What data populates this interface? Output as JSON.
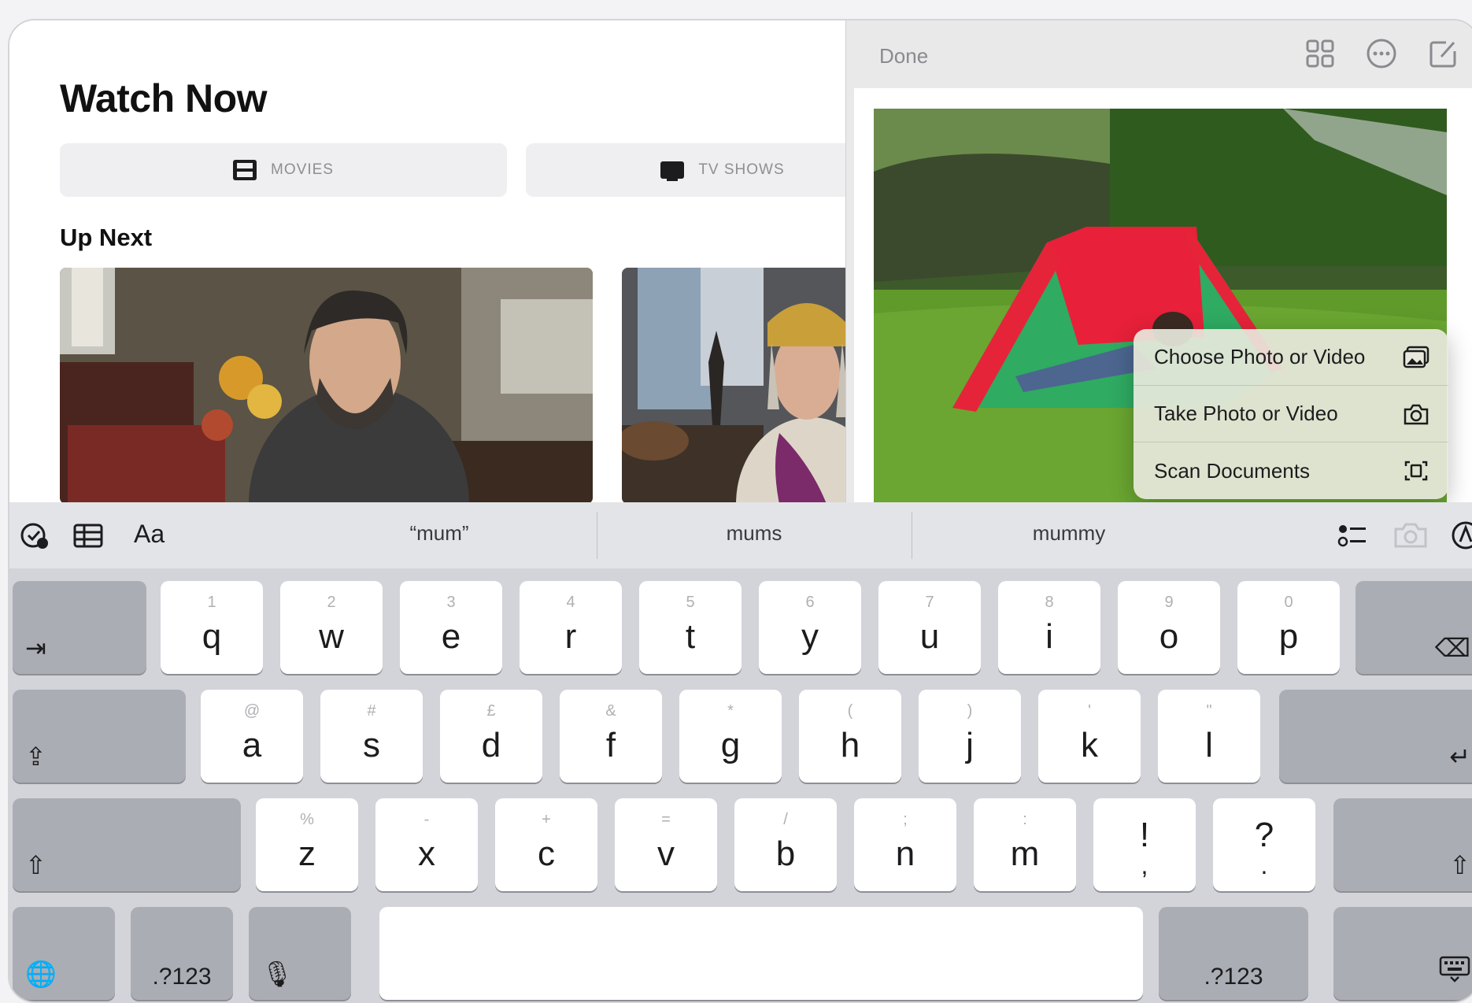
{
  "tv_app": {
    "title": "Watch Now",
    "segments": [
      "MOVIES",
      "TV SHOWS"
    ],
    "section_title": "Up Next"
  },
  "notes": {
    "done_label": "Done",
    "toolbar_icons": [
      "gallery-grid-icon",
      "more-ellipsis-icon",
      "compose-icon"
    ]
  },
  "attach_menu": {
    "items": [
      {
        "label": "Choose Photo or Video",
        "icon": "photo-library-icon"
      },
      {
        "label": "Take Photo or Video",
        "icon": "camera-icon"
      },
      {
        "label": "Scan Documents",
        "icon": "scan-document-icon"
      }
    ]
  },
  "keyboard": {
    "suggestions": [
      "“mum”",
      "mums",
      "mummy"
    ],
    "quick_icons_left": [
      "checklist-text-icon",
      "table-icon",
      "format-text-icon"
    ],
    "format_label": "Aa",
    "quick_icons_right": [
      "checklist-icon",
      "camera-icon",
      "markup-icon"
    ],
    "row1": [
      {
        "main": "q",
        "hint": "1"
      },
      {
        "main": "w",
        "hint": "2"
      },
      {
        "main": "e",
        "hint": "3"
      },
      {
        "main": "r",
        "hint": "4"
      },
      {
        "main": "t",
        "hint": "5"
      },
      {
        "main": "y",
        "hint": "6"
      },
      {
        "main": "u",
        "hint": "7"
      },
      {
        "main": "i",
        "hint": "8"
      },
      {
        "main": "o",
        "hint": "9"
      },
      {
        "main": "p",
        "hint": "0"
      }
    ],
    "row2": [
      {
        "main": "a",
        "hint": "@"
      },
      {
        "main": "s",
        "hint": "#"
      },
      {
        "main": "d",
        "hint": "£"
      },
      {
        "main": "f",
        "hint": "&"
      },
      {
        "main": "g",
        "hint": "*"
      },
      {
        "main": "h",
        "hint": "("
      },
      {
        "main": "j",
        "hint": ")"
      },
      {
        "main": "k",
        "hint": "'"
      },
      {
        "main": "l",
        "hint": "\""
      }
    ],
    "row3": [
      {
        "main": "z",
        "hint": "%"
      },
      {
        "main": "x",
        "hint": "-"
      },
      {
        "main": "c",
        "hint": "+"
      },
      {
        "main": "v",
        "hint": "="
      },
      {
        "main": "b",
        "hint": "/"
      },
      {
        "main": "n",
        "hint": ";"
      },
      {
        "main": "m",
        "hint": ":"
      }
    ],
    "punct": [
      {
        "top": "!",
        "bottom": ","
      },
      {
        "top": "?",
        "bottom": "."
      }
    ],
    "tab_symbol": "⇥",
    "delete_symbol": "⌫",
    "caps_symbol": "⇪",
    "return_symbol": "↵",
    "shift_symbol": "⇧",
    "numbers_label": ".?123",
    "globe_symbol": "🌐",
    "mic_symbol": "🎙"
  }
}
